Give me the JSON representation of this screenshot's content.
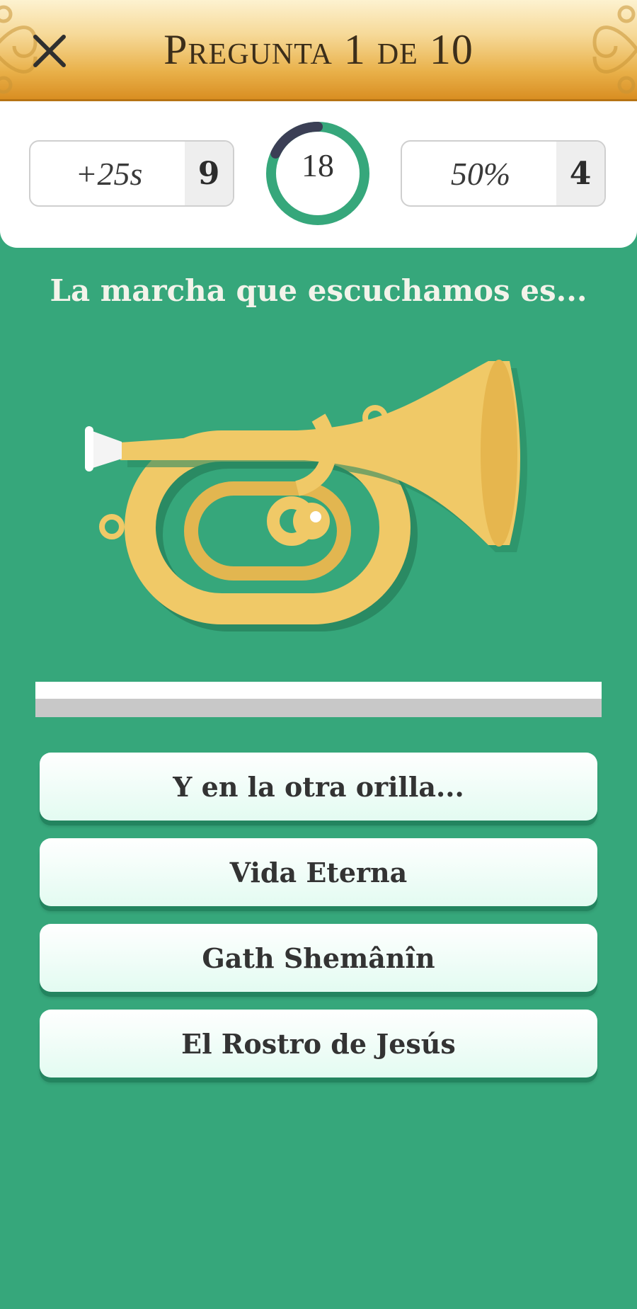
{
  "header": {
    "title": "Pregunta 1 de 10",
    "close_icon": "close-icon"
  },
  "stats": {
    "time_bonus": {
      "label": "+25s",
      "count": "9"
    },
    "timer": {
      "value": "18",
      "remaining_fraction": 0.82,
      "track_color": "#36a77b",
      "elapsed_color": "#3b3f55"
    },
    "fifty_fifty": {
      "label": "50%",
      "count": "4"
    }
  },
  "question": {
    "text": "La marcha que escuchamos es...",
    "illustration": "horn-icon"
  },
  "audio_progress": {
    "fraction": 1.0
  },
  "answers": [
    {
      "label": "Y en la otra orilla..."
    },
    {
      "label": "Vida Eterna"
    },
    {
      "label": "Gath Shemânîn"
    },
    {
      "label": "El Rostro de Jesús"
    }
  ],
  "colors": {
    "background": "#36a77b",
    "header_gold": "#e9b14a",
    "answer_shadow": "#23845f"
  }
}
